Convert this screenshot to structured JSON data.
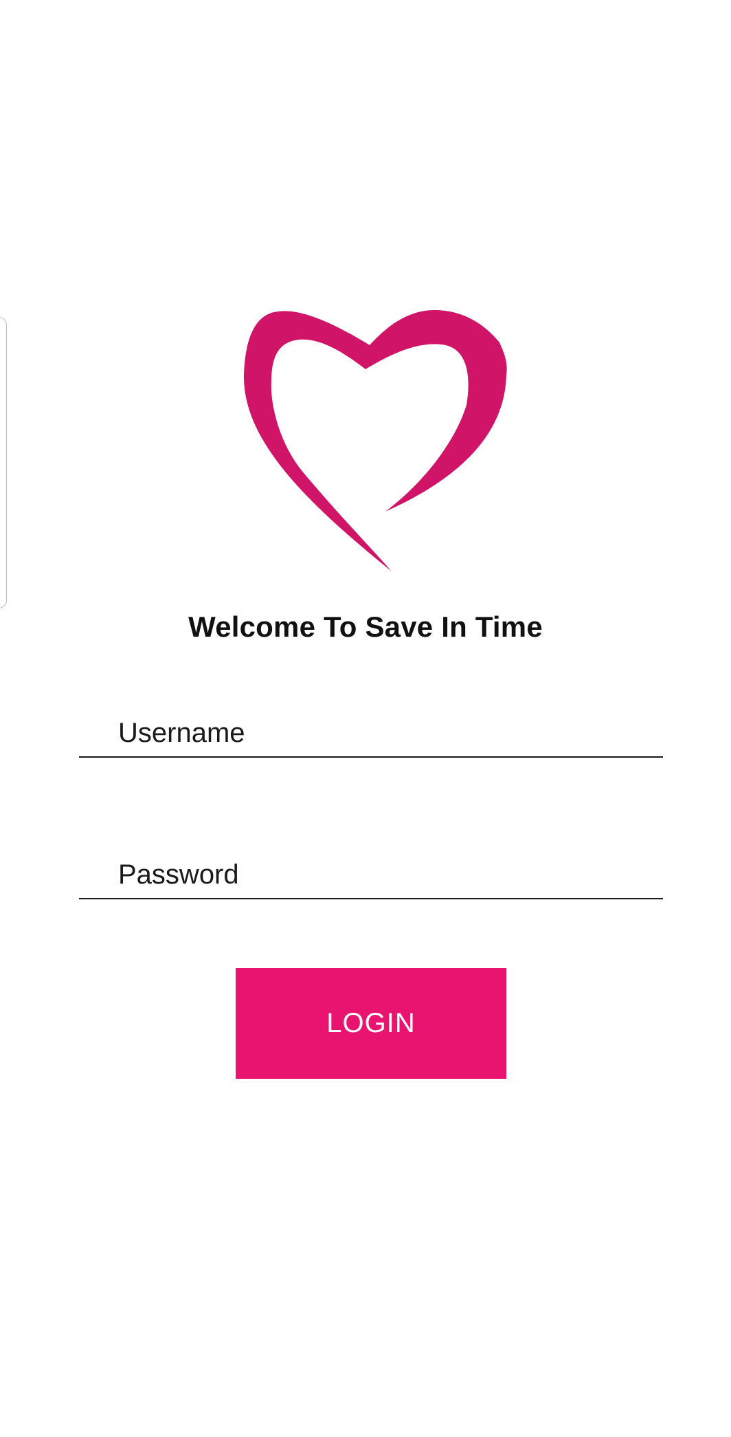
{
  "app": {
    "welcome_text": "Welcome To Save In Time",
    "brand_color": "#e91470",
    "logo_color": "#d01467",
    "logo_icon": "heart-icon"
  },
  "form": {
    "username": {
      "placeholder": "Username",
      "value": ""
    },
    "password": {
      "placeholder": "Password",
      "value": ""
    },
    "login_label": "LOGIN"
  }
}
